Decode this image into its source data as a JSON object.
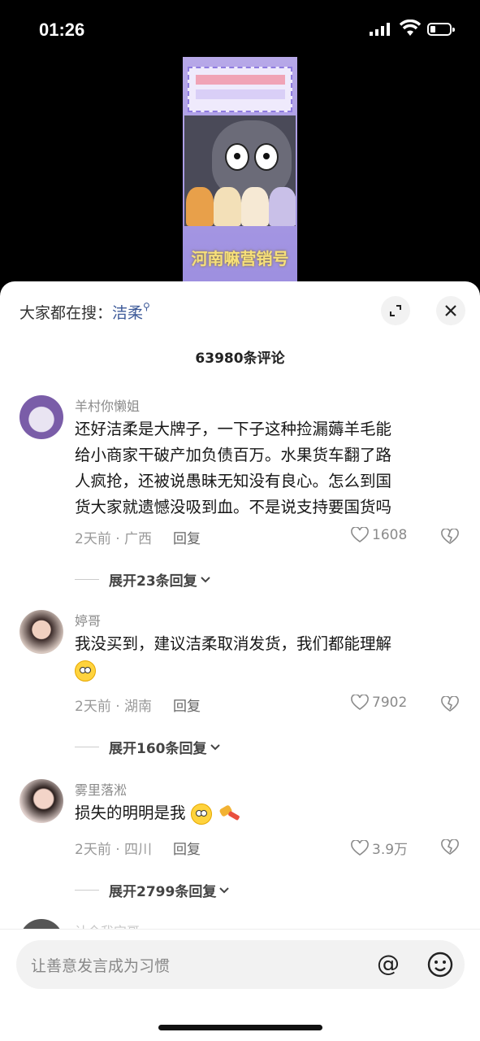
{
  "status_bar": {
    "time": "01:26"
  },
  "video": {
    "title": "河南嘛营销号"
  },
  "sheet": {
    "search_prefix": "大家都在搜：",
    "search_keyword": "洁柔",
    "comment_count": "63980条评论"
  },
  "comments": [
    {
      "username": "羊村你懒姐",
      "lines": [
        "还好洁柔是大牌子，一下子这种捡漏薅羊毛能",
        "给小商家干破产加负债百万。水果货车翻了路",
        "人疯抢，还被说愚昧无知没有良心。怎么到国",
        "货大家就遗憾没吸到血。不是说支持要国货吗"
      ],
      "time_location": "2天前 · 广西",
      "reply_label": "回复",
      "likes": "1608",
      "expand_label": "展开23条回复"
    },
    {
      "username": "婷哥",
      "lines": [
        "我没买到，建议洁柔取消发货，我们都能理解"
      ],
      "time_location": "2天前 · 湖南",
      "reply_label": "回复",
      "likes": "7902",
      "expand_label": "展开160条回复"
    },
    {
      "username": "雾里落淞",
      "lines": [
        "损失的明明是我"
      ],
      "time_location": "2天前 · 四川",
      "reply_label": "回复",
      "likes": "3.9万",
      "expand_label": "展开2799条回复"
    },
    {
      "username": "计今我它哥"
    }
  ],
  "input": {
    "placeholder": "让善意发言成为习惯"
  },
  "colors": {
    "keyword": "#3d5a99",
    "sheet_bg": "#ffffff",
    "input_bg": "#f2f2f2"
  }
}
